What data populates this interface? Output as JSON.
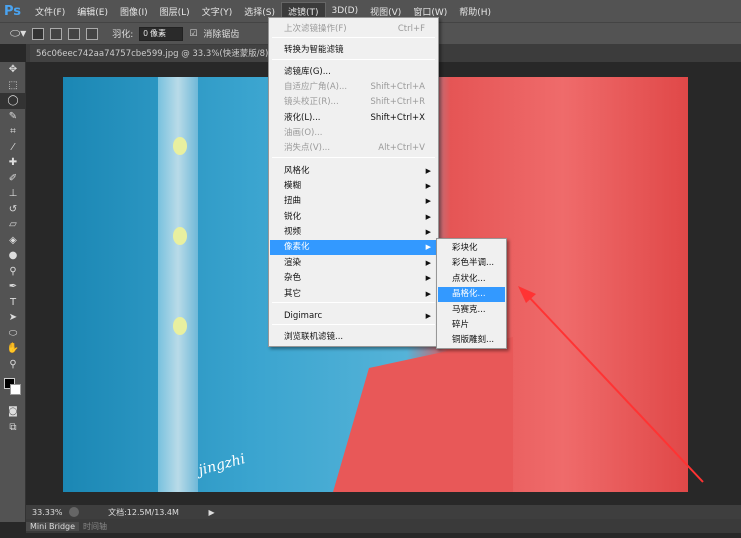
{
  "app": {
    "logo": "Ps"
  },
  "menubar": [
    "文件(F)",
    "编辑(E)",
    "图像(I)",
    "图层(L)",
    "文字(Y)",
    "选择(S)",
    "滤镜(T)",
    "3D(D)",
    "视图(V)",
    "窗口(W)",
    "帮助(H)"
  ],
  "options": {
    "feather_label": "羽化:",
    "feather_value": "0 像素",
    "antialias_label": "消除锯齿"
  },
  "document": {
    "tab": "56c06eec742aa74757cbe599.jpg @ 33.3%(快速蒙版/8) *",
    "watermark": "jingzhi"
  },
  "status": {
    "zoom": "33.33%",
    "doc": "文档:12.5M/13.4M"
  },
  "panels": {
    "tab1": "Mini Bridge",
    "tab2": "时间轴"
  },
  "filter_menu": [
    {
      "label": "上次滤镜操作(F)",
      "shortcut": "Ctrl+F",
      "disabled": true
    },
    {
      "label": "转换为智能滤镜"
    },
    {
      "label": "滤镜库(G)..."
    },
    {
      "label": "自适应广角(A)...",
      "shortcut": "Shift+Ctrl+A",
      "disabled": true
    },
    {
      "label": "镜头校正(R)...",
      "shortcut": "Shift+Ctrl+R",
      "disabled": true
    },
    {
      "label": "液化(L)...",
      "shortcut": "Shift+Ctrl+X"
    },
    {
      "label": "油画(O)...",
      "disabled": true
    },
    {
      "label": "消失点(V)...",
      "shortcut": "Alt+Ctrl+V",
      "disabled": true
    },
    {
      "label": "风格化",
      "sub": true
    },
    {
      "label": "模糊",
      "sub": true
    },
    {
      "label": "扭曲",
      "sub": true
    },
    {
      "label": "锐化",
      "sub": true
    },
    {
      "label": "视频",
      "sub": true
    },
    {
      "label": "像素化",
      "sub": true,
      "highlight": true
    },
    {
      "label": "渲染",
      "sub": true
    },
    {
      "label": "杂色",
      "sub": true
    },
    {
      "label": "其它",
      "sub": true
    },
    {
      "label": "Digimarc",
      "sub": true
    },
    {
      "label": "浏览联机滤镜..."
    }
  ],
  "pixelate_menu": [
    {
      "label": "彩块化"
    },
    {
      "label": "彩色半调..."
    },
    {
      "label": "点状化..."
    },
    {
      "label": "晶格化...",
      "highlight": true
    },
    {
      "label": "马赛克..."
    },
    {
      "label": "碎片"
    },
    {
      "label": "铜版雕刻..."
    }
  ],
  "colors": {
    "highlight": "#3399ff",
    "arrow": "#ff3333"
  }
}
